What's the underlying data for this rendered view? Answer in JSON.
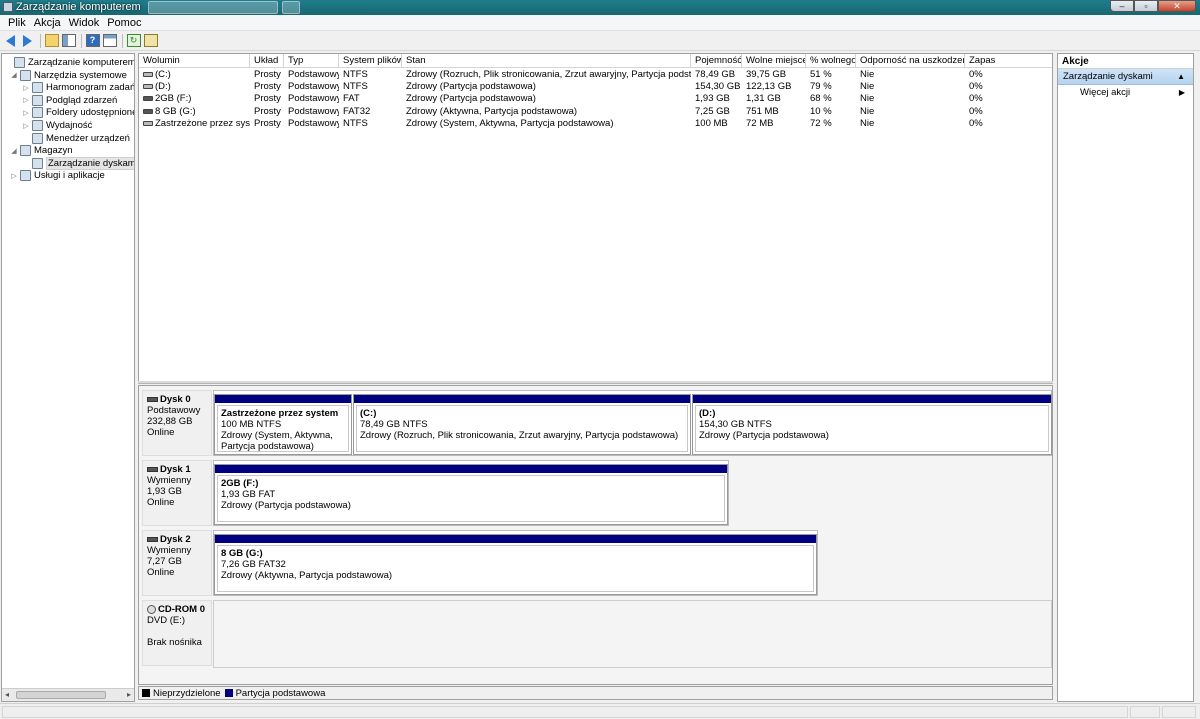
{
  "window": {
    "title": "Zarządzanie komputerem"
  },
  "menu": [
    "Plik",
    "Akcja",
    "Widok",
    "Pomoc"
  ],
  "toolbar": [
    "back-icon",
    "forward-icon",
    "up-folder-icon",
    "show-hide-tree-icon",
    "help-icon",
    "properties-icon",
    "refresh-icon",
    "export-icon"
  ],
  "tree": [
    {
      "label": "Zarządzanie komputerem (lokalny)",
      "level": 0,
      "exp": ""
    },
    {
      "label": "Narzędzia systemowe",
      "level": 1,
      "exp": "◢"
    },
    {
      "label": "Harmonogram zadań",
      "level": 2,
      "exp": "▷"
    },
    {
      "label": "Podgląd zdarzeń",
      "level": 2,
      "exp": "▷"
    },
    {
      "label": "Foldery udostępnione",
      "level": 2,
      "exp": "▷"
    },
    {
      "label": "Wydajność",
      "level": 2,
      "exp": "▷"
    },
    {
      "label": "Menedżer urządzeń",
      "level": 2,
      "exp": ""
    },
    {
      "label": "Magazyn",
      "level": 1,
      "exp": "◢"
    },
    {
      "label": "Zarządzanie dyskami",
      "level": 2,
      "exp": "",
      "selected": true
    },
    {
      "label": "Usługi i aplikacje",
      "level": 1,
      "exp": "▷"
    }
  ],
  "columns": [
    "Wolumin",
    "Układ",
    "Typ",
    "System plików",
    "Stan",
    "Pojemność",
    "Wolne miejsce",
    "% wolnego",
    "Odporność na uszkodzenia",
    "Zapas"
  ],
  "volumes": [
    [
      "(C:)",
      "Prosty",
      "Podstawowy",
      "NTFS",
      "Zdrowy (Rozruch, Plik stronicowania, Zrzut awaryjny, Partycja podstawowa)",
      "78,49 GB",
      "39,75 GB",
      "51 %",
      "Nie",
      "0%"
    ],
    [
      "(D:)",
      "Prosty",
      "Podstawowy",
      "NTFS",
      "Zdrowy (Partycja podstawowa)",
      "154,30 GB",
      "122,13 GB",
      "79 %",
      "Nie",
      "0%"
    ],
    [
      "2GB (F:)",
      "Prosty",
      "Podstawowy",
      "FAT",
      "Zdrowy (Partycja podstawowa)",
      "1,93 GB",
      "1,31 GB",
      "68 %",
      "Nie",
      "0%"
    ],
    [
      "8 GB (G:)",
      "Prosty",
      "Podstawowy",
      "FAT32",
      "Zdrowy (Aktywna, Partycja podstawowa)",
      "7,25 GB",
      "751 MB",
      "10 %",
      "Nie",
      "0%"
    ],
    [
      "Zastrzeżone przez system",
      "Prosty",
      "Podstawowy",
      "NTFS",
      "Zdrowy (System, Aktywna, Partycja podstawowa)",
      "100 MB",
      "72 MB",
      "72 %",
      "Nie",
      "0%"
    ]
  ],
  "disks": [
    {
      "name": "Dysk 0",
      "type": "Podstawowy",
      "size": "232,88 GB",
      "status": "Online",
      "partitions": [
        {
          "name": "Zastrzeżone przez system",
          "info": "100 MB NTFS",
          "status": "Zdrowy (System, Aktywna, Partycja podstawowa)"
        },
        {
          "name": "(C:)",
          "info": "78,49 GB NTFS",
          "status": "Zdrowy (Rozruch, Plik stronicowania, Zrzut awaryjny, Partycja podstawowa)"
        },
        {
          "name": "(D:)",
          "info": "154,30 GB NTFS",
          "status": "Zdrowy (Partycja podstawowa)"
        }
      ]
    },
    {
      "name": "Dysk 1",
      "type": "Wymienny",
      "size": "1,93 GB",
      "status": "Online",
      "partitions": [
        {
          "name": "2GB  (F:)",
          "info": "1,93 GB FAT",
          "status": "Zdrowy (Partycja podstawowa)"
        }
      ]
    },
    {
      "name": "Dysk 2",
      "type": "Wymienny",
      "size": "7,27 GB",
      "status": "Online",
      "partitions": [
        {
          "name": "8 GB  (G:)",
          "info": "7,26 GB FAT32",
          "status": "Zdrowy (Aktywna, Partycja podstawowa)"
        }
      ]
    },
    {
      "name": "CD-ROM 0",
      "type": "DVD (E:)",
      "size": "",
      "status": "Brak nośnika",
      "partitions": []
    }
  ],
  "legend": [
    {
      "label": "Nieprzydzielone",
      "color": "#000000"
    },
    {
      "label": "Partycja podstawowa",
      "color": "#000080"
    }
  ],
  "actions": {
    "title": "Akcje",
    "section": "Zarządzanie dyskami",
    "more": "Więcej akcji"
  },
  "colors": {
    "partition_bar": "#000080",
    "selection": "#b6d3ef"
  }
}
